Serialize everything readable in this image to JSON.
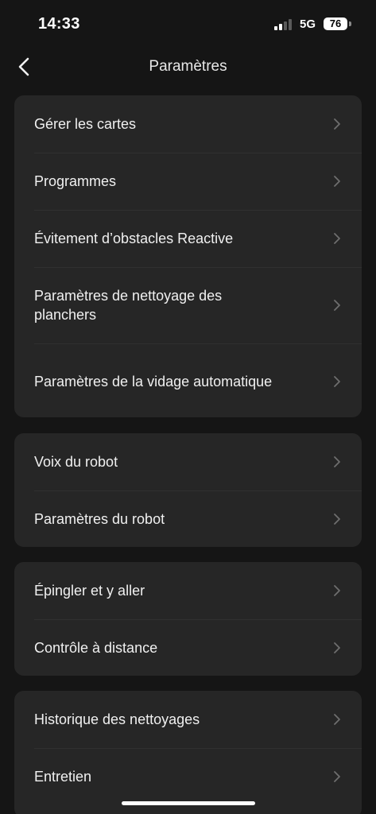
{
  "status_bar": {
    "time": "14:33",
    "network": "5G",
    "battery": "76"
  },
  "nav": {
    "title": "Paramètres",
    "back_icon": "chevron-left-icon"
  },
  "groups": [
    {
      "items": [
        {
          "label": "Gérer les cartes"
        },
        {
          "label": "Programmes"
        },
        {
          "label": "Évitement d’obstacles Reactive"
        },
        {
          "label": "Paramètres de nettoyage des planchers"
        },
        {
          "label": "Paramètres de la vidage automatique"
        }
      ]
    },
    {
      "items": [
        {
          "label": "Voix du robot"
        },
        {
          "label": "Paramètres du robot"
        }
      ]
    },
    {
      "items": [
        {
          "label": "Épingler et y aller"
        },
        {
          "label": "Contrôle à distance"
        }
      ]
    },
    {
      "items": [
        {
          "label": "Historique des nettoyages"
        },
        {
          "label": "Entretien"
        }
      ]
    }
  ],
  "colors": {
    "background": "#151515",
    "card": "#262626",
    "chevron": "#6e6e6e",
    "text": "#f0f0f0"
  }
}
